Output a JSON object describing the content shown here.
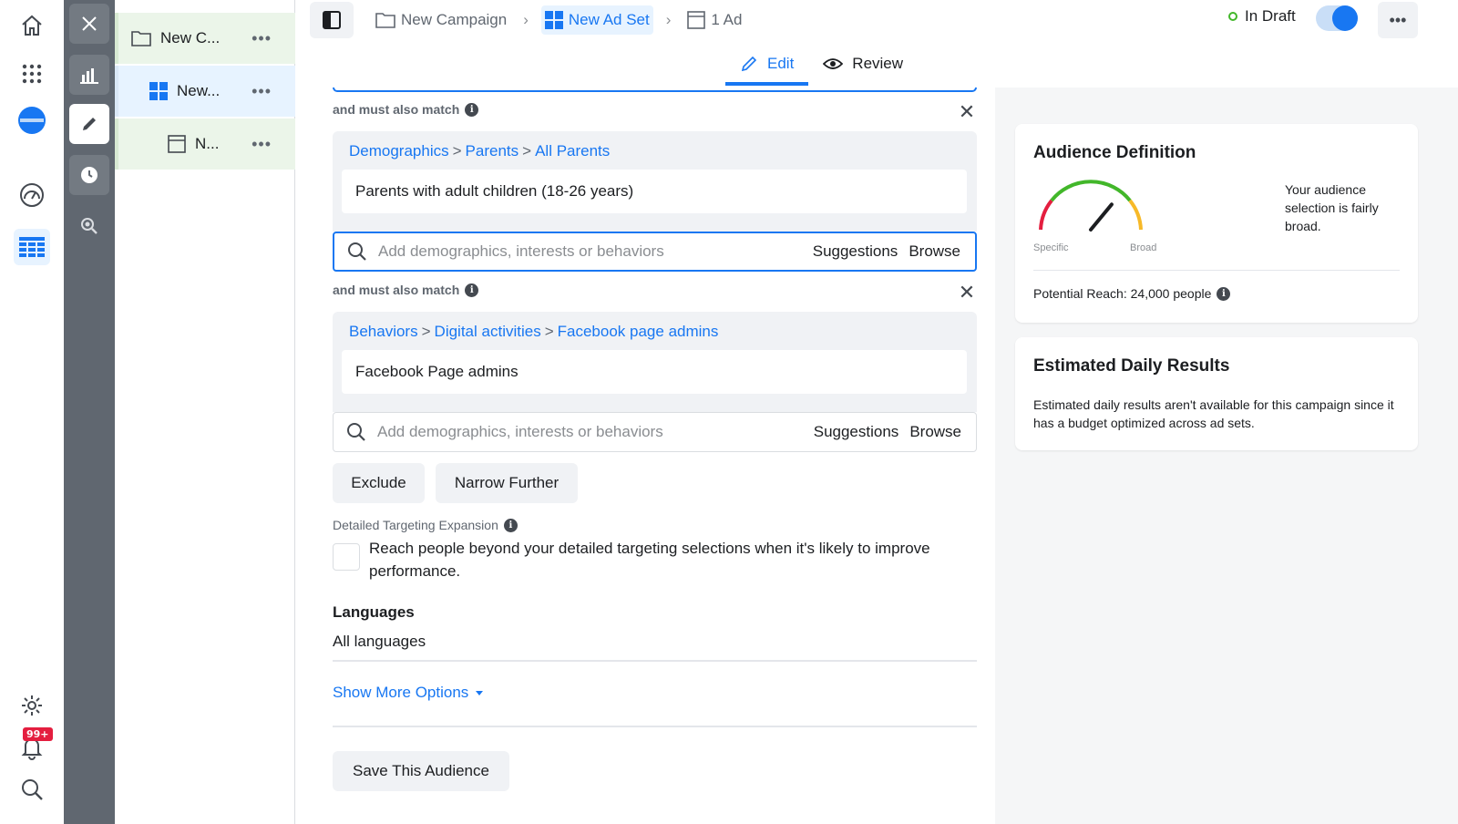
{
  "rail": {
    "notification_count": "99+"
  },
  "tree": {
    "items": [
      {
        "label": "New C...",
        "icon": "folder-icon"
      },
      {
        "label": "New...",
        "icon": "grid-icon"
      },
      {
        "label": "N...",
        "icon": "ad-icon"
      }
    ],
    "more": "•••"
  },
  "breadcrumb": {
    "campaign": "New Campaign",
    "adset": "New Ad Set",
    "ad": "1 Ad"
  },
  "status": {
    "label": "In Draft"
  },
  "top_more": "•••",
  "tabs": {
    "edit": "Edit",
    "review": "Review"
  },
  "targeting": {
    "match_label": "and must also match",
    "group1": {
      "path": [
        "Demographics",
        "Parents",
        "All Parents"
      ],
      "item": "Parents with adult children (18-26 years)"
    },
    "group2": {
      "path": [
        "Behaviors",
        "Digital activities",
        "Facebook page admins"
      ],
      "item": "Facebook Page admins"
    },
    "search_placeholder": "Add demographics, interests or behaviors",
    "suggestions": "Suggestions",
    "browse": "Browse",
    "path_sep": ">",
    "exclude": "Exclude",
    "narrow_further": "Narrow Further",
    "close": "✕"
  },
  "expansion": {
    "label": "Detailed Targeting Expansion",
    "text": "Reach people beyond your detailed targeting selections when it's likely to improve performance.",
    "checked": false
  },
  "languages": {
    "title": "Languages",
    "value": "All languages"
  },
  "show_more": "Show More Options",
  "save_audience": "Save This Audience",
  "audience": {
    "title": "Audience Definition",
    "gauge_specific": "Specific",
    "gauge_broad": "Broad",
    "gauge_level": 0.72,
    "description": "Your audience selection is fairly broad.",
    "potential_reach": "Potential Reach: 24,000 people"
  },
  "estimated": {
    "title": "Estimated Daily Results",
    "text": "Estimated daily results aren't available for this campaign since it has a budget optimized across ad sets."
  },
  "colors": {
    "accent": "#1877f2",
    "draft_green": "#42b72a",
    "gauge_red": "#e41e3f",
    "gauge_green": "#42b72a",
    "gauge_orange": "#f7b928"
  }
}
